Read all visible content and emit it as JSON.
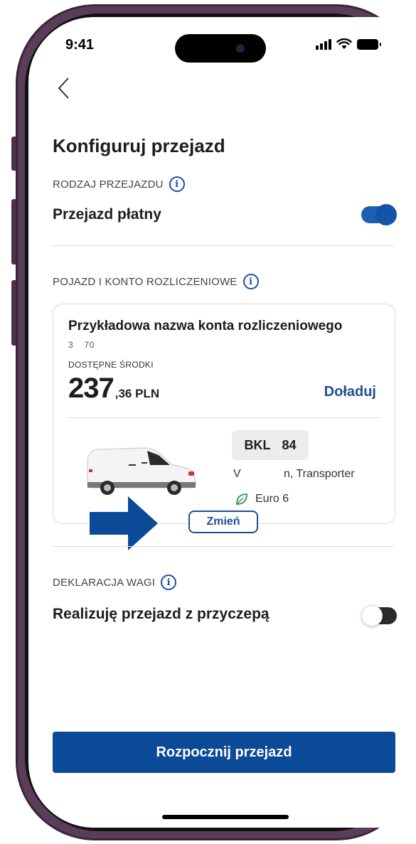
{
  "status_bar": {
    "time": "9:41"
  },
  "header": {
    "title": "Konfiguruj przejazd"
  },
  "ride_type": {
    "section_label": "RODZAJ PRZEJAZDU",
    "row_label": "Przejazd płatny",
    "toggle_on": true
  },
  "vehicle_account": {
    "section_label": "POJAZD I KONTO ROZLICZENIOWE",
    "account_name": "Przykładowa nazwa konta rozliczeniowego",
    "account_number": "3    70",
    "funds_label": "DOSTĘPNE ŚRODKI",
    "amount_integer": "237",
    "amount_decimal": ",36 PLN",
    "topup_label": "Doładuj",
    "plate_prefix": "BKL",
    "plate_suffix": "84",
    "vehicle_model_left": "V",
    "vehicle_model_right": "n, Transporter",
    "emission_class": "Euro 6",
    "change_label": "Zmień"
  },
  "weight_declaration": {
    "section_label": "DEKLARACJA WAGI",
    "row_label": "Realizuję przejazd z przyczepą",
    "toggle_on": false
  },
  "footer": {
    "start_label": "Rozpocznij przejazd"
  },
  "colors": {
    "primary": "#0b4a96",
    "link": "#1e4f94",
    "toggle_on": "#1553a8",
    "frame": "#5a3d59",
    "leaf": "#2e9a4a"
  }
}
